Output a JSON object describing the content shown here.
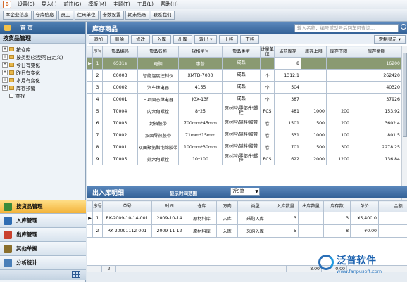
{
  "menubar": {
    "items": [
      "设置(S)",
      "导入(I)",
      "前往(G)",
      "模板(M)",
      "主题(T)",
      "工具(L)",
      "帮助(H)"
    ]
  },
  "modules": [
    "本企业信息",
    "仓库信息",
    "员工",
    "往来单位",
    "参数设置",
    "期末结账",
    "联系我们"
  ],
  "sidebar": {
    "home_label": "首 页",
    "section_title": "按货品管理",
    "tree": [
      {
        "label": "按仓库",
        "toggle": "+",
        "type": "folder"
      },
      {
        "label": "按类型(类型可自定义)",
        "toggle": "+",
        "type": "folder"
      },
      {
        "label": "今日有变化",
        "toggle": "+",
        "type": "folder"
      },
      {
        "label": "昨日有变化",
        "toggle": "+",
        "type": "folder"
      },
      {
        "label": "本月有变化",
        "toggle": "+",
        "type": "folder"
      },
      {
        "label": "库存预警",
        "toggle": "+",
        "type": "folder"
      },
      {
        "label": "查找",
        "toggle": "",
        "type": "leaf"
      }
    ],
    "nav": [
      {
        "label": "按货品管理",
        "active": true,
        "color": "#3a8a3a"
      },
      {
        "label": "入库管理",
        "active": false,
        "color": "#2f6db3"
      },
      {
        "label": "出库管理",
        "active": false,
        "color": "#c9412e"
      },
      {
        "label": "其他单据",
        "active": false,
        "color": "#8a6f2c"
      },
      {
        "label": "分析统计",
        "active": false,
        "color": "#4a7fb8"
      }
    ]
  },
  "stock": {
    "title": "库存商品",
    "search_placeholder": "输入名称，编号或型号后回车可查询...",
    "actions": [
      "添加",
      "删除",
      "修改",
      "入库",
      "出库",
      "输出",
      "上移",
      "下移"
    ],
    "custom_display": "定制显示",
    "columns": [
      "序号",
      "货品编码",
      "货品名称",
      "规格型号",
      "货品类型",
      "计量单位",
      "当前库存",
      "库存上限",
      "库存下限",
      "库存金额"
    ],
    "rows": [
      [
        "1",
        "6531s",
        "电脑",
        "惠普",
        "成品",
        "",
        "8",
        "",
        "",
        "16200"
      ],
      [
        "2",
        "C0003",
        "智能温度控制仪",
        "XMTD-7000",
        "成品",
        "个",
        "1312.1",
        "",
        "",
        "262420"
      ],
      [
        "3",
        "C0002",
        "汽车继电器",
        "4155",
        "成品",
        "个",
        "504",
        "",
        "",
        "40320"
      ],
      [
        "4",
        "C0001",
        "三项固态继电器",
        "JGX-13F",
        "成品",
        "个",
        "387",
        "",
        "",
        "37926"
      ],
      [
        "5",
        "T0004",
        "内六角螺栓",
        "8*25",
        "原材料\\零部件\\螺栓",
        "PCS",
        "481",
        "1000",
        "200",
        "153.92"
      ],
      [
        "6",
        "T0003",
        "封箱胶带",
        "700mm*45mm",
        "原材料\\辅料\\胶带",
        "卷",
        "1501",
        "500",
        "200",
        "3602.4"
      ],
      [
        "7",
        "T0002",
        "双面导热胶带",
        "71mm*15mm",
        "原材料\\辅料\\胶带",
        "卷",
        "531",
        "1000",
        "100",
        "801.5"
      ],
      [
        "8",
        "T0001",
        "双面聚氨酯泡绵胶带",
        "100mm*30mm",
        "原材料\\辅料\\胶带",
        "卷",
        "701",
        "500",
        "300",
        "2278.25"
      ],
      [
        "9",
        "T0005",
        "外六角螺栓",
        "10*100",
        "原材料\\零部件\\螺栓",
        "PCS",
        "622",
        "2000",
        "1200",
        "136.84"
      ]
    ]
  },
  "io": {
    "title": "出入库明细",
    "range_label": "显示时间范围",
    "range_value": "近5笔",
    "columns": [
      "序号",
      "单号",
      "时间",
      "仓库",
      "方向",
      "类型",
      "入库数量",
      "出库数量",
      "库存数",
      "单价",
      "金额"
    ],
    "rows": [
      [
        "1",
        "RK-2009-10-14-001",
        "2009-10-14",
        "原材料库",
        "入库",
        "采购入库",
        "3",
        "",
        "3",
        "¥5,400.0",
        "¥16"
      ],
      [
        "2",
        "RK-20091112-001",
        "2009-11-12",
        "原材料库",
        "入库",
        "采购入库",
        "5",
        "",
        "8",
        "¥0.00",
        "¥"
      ]
    ],
    "footer": {
      "count": "2",
      "in_total": "8.00",
      "out_total": "0.00"
    }
  },
  "watermark": {
    "name": "泛普软件",
    "url": "www.fanpusoft.com"
  }
}
